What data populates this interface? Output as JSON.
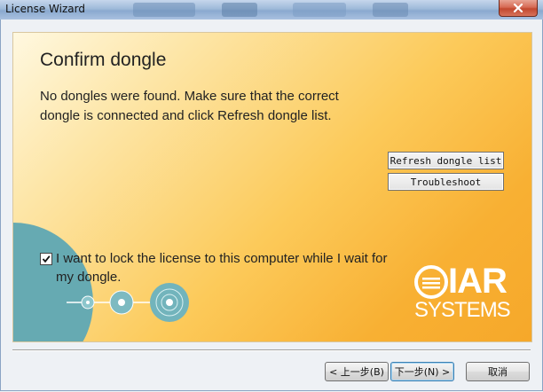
{
  "window": {
    "title": "License Wizard"
  },
  "panel": {
    "heading": "Confirm dongle",
    "message": "No dongles were found. Make sure that the correct dongle is connected and click Refresh dongle list.",
    "refresh_button": "Refresh dongle list",
    "troubleshoot_button": "Troubleshoot",
    "lock_checkbox": {
      "checked": true,
      "label": "I want to lock the license to this computer while I wait for my dongle."
    },
    "logo": {
      "line1": "IAR",
      "line2": "SYSTEMS"
    }
  },
  "footer": {
    "back_button": "< 上一步(B)",
    "next_button": "下一步(N) >",
    "cancel_button": "取消"
  },
  "colors": {
    "panel_orange": "#f8b033",
    "teal": "#66aab2"
  }
}
